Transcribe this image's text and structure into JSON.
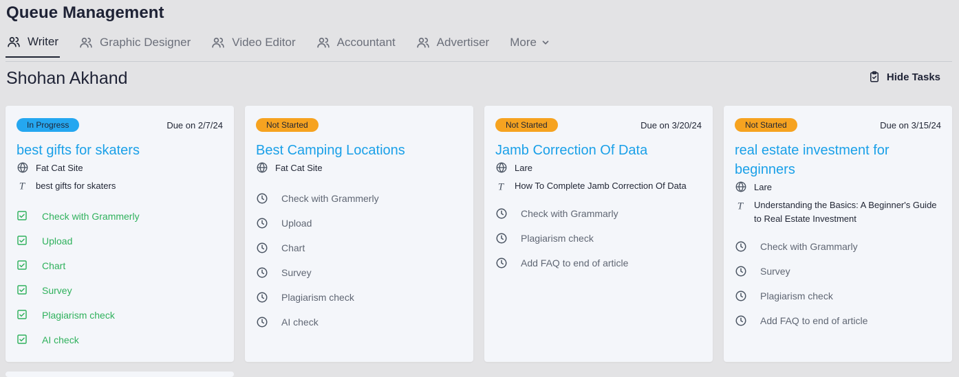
{
  "app": {
    "title": "Queue Management"
  },
  "tabs": [
    {
      "label": "Writer",
      "icon": "users-icon",
      "active": true
    },
    {
      "label": "Graphic Designer",
      "icon": "users-icon"
    },
    {
      "label": "Video Editor",
      "icon": "users-icon"
    },
    {
      "label": "Accountant",
      "icon": "users-icon"
    },
    {
      "label": "Advertiser",
      "icon": "users-icon"
    },
    {
      "label": "More",
      "icon": "chevron-down-icon"
    }
  ],
  "person": {
    "name": "Shohan Akhand"
  },
  "actions": {
    "hide_tasks": "Hide Tasks"
  },
  "colors": {
    "accent_blue": "#1aa0e8",
    "in_progress": "#25a7f0",
    "not_started": "#f6a320",
    "done_green": "#2fb15c"
  },
  "cards": [
    {
      "status": "In Progress",
      "due": "Due on 2/7/24",
      "title": "best gifts for skaters",
      "site": "Fat Cat Site",
      "topic": "best gifts for skaters",
      "tasks": [
        {
          "label": "Check with Grammerly",
          "done": true
        },
        {
          "label": "Upload",
          "done": true
        },
        {
          "label": "Chart",
          "done": true
        },
        {
          "label": "Survey",
          "done": true
        },
        {
          "label": "Plagiarism check",
          "done": true
        },
        {
          "label": "AI check",
          "done": true
        }
      ]
    },
    {
      "status": "Not Started",
      "due": "",
      "title": "Best Camping Locations",
      "site": "Fat Cat Site",
      "topic": "",
      "tasks": [
        {
          "label": "Check with Grammerly",
          "done": false
        },
        {
          "label": "Upload",
          "done": false
        },
        {
          "label": "Chart",
          "done": false
        },
        {
          "label": "Survey",
          "done": false
        },
        {
          "label": "Plagiarism check",
          "done": false
        },
        {
          "label": "AI check",
          "done": false
        }
      ]
    },
    {
      "status": "Not Started",
      "due": "Due on 3/20/24",
      "title": "Jamb Correction Of Data",
      "site": "Lare",
      "topic": "How To Complete Jamb Correction Of Data",
      "tasks": [
        {
          "label": "Check with Grammarly",
          "done": false
        },
        {
          "label": "Plagiarism check",
          "done": false
        },
        {
          "label": "Add FAQ to end of article",
          "done": false
        }
      ]
    },
    {
      "status": "Not Started",
      "due": "Due on 3/15/24",
      "title": "real estate investment for beginners",
      "site": "Lare",
      "topic": "Understanding the Basics: A Beginner's Guide to Real Estate Investment",
      "tasks": [
        {
          "label": "Check with Grammarly",
          "done": false
        },
        {
          "label": "Survey",
          "done": false
        },
        {
          "label": "Plagiarism check",
          "done": false
        },
        {
          "label": "Add FAQ to end of article",
          "done": false
        }
      ]
    }
  ]
}
